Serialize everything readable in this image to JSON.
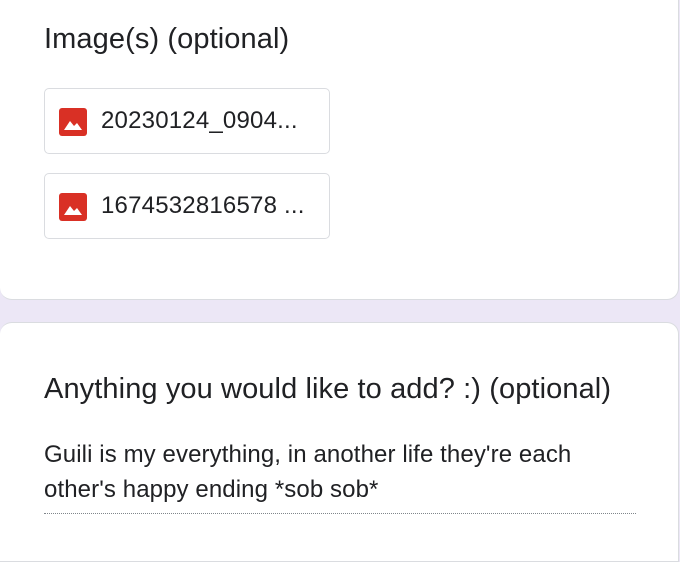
{
  "images_question": {
    "title": "Image(s) (optional)",
    "files": [
      {
        "name": "20230124_0904...",
        "icon": "image-file-icon"
      },
      {
        "name": "1674532816578 ...",
        "icon": "image-file-icon"
      }
    ]
  },
  "add_question": {
    "title": "Anything you would like to add? :) (optional)",
    "answer": "Guili is my everything, in another life they're each other's happy ending *sob sob*"
  },
  "colors": {
    "background": "#ece7f6",
    "card": "#ffffff",
    "image_icon": "#d93025"
  }
}
